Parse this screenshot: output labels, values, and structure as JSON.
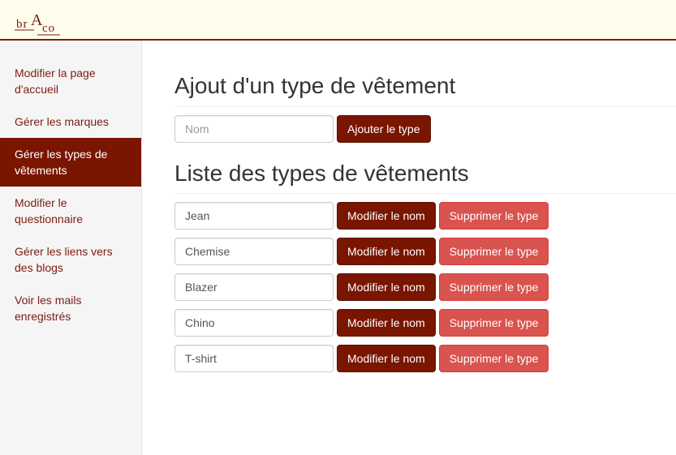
{
  "colors": {
    "accent": "#7a1500",
    "danger": "#d9534f",
    "topbar_bg": "#fefdec",
    "sidebar_bg": "#f5f5f5"
  },
  "logo": {
    "text": "brAco"
  },
  "sidebar": {
    "items": [
      {
        "label": "Modifier la page d'accueil",
        "active": false
      },
      {
        "label": "Gérer les marques",
        "active": false
      },
      {
        "label": "Gérer les types de vêtements",
        "active": true
      },
      {
        "label": "Modifier le questionnaire",
        "active": false
      },
      {
        "label": "Gérer les liens vers des blogs",
        "active": false
      },
      {
        "label": "Voir les mails enregistrés",
        "active": false
      }
    ]
  },
  "add_section": {
    "title": "Ajout d'un type de vêtement",
    "name_placeholder": "Nom",
    "add_button": "Ajouter le type"
  },
  "list_section": {
    "title": "Liste des types de vêtements",
    "rename_button": "Modifier le nom",
    "delete_button": "Supprimer le type",
    "items": [
      "Jean",
      "Chemise",
      "Blazer",
      "Chino",
      "T-shirt"
    ]
  }
}
